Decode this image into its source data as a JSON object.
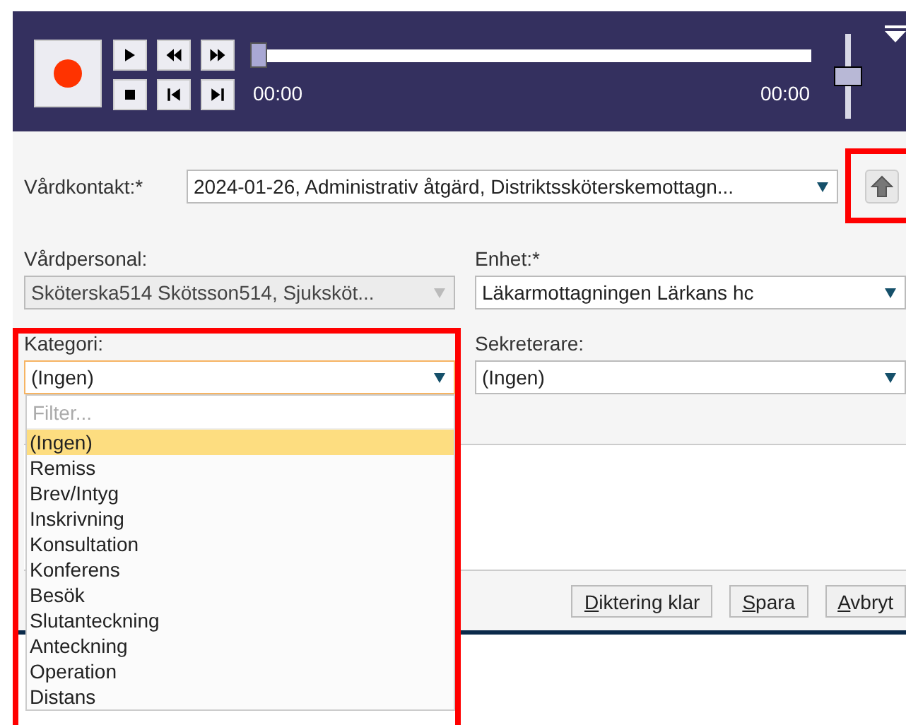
{
  "player": {
    "elapsed": "00:00",
    "duration": "00:00",
    "progress": {
      "level": 0
    },
    "volume": {
      "level": 0.5
    }
  },
  "contact": {
    "label": "Vårdkontakt:*",
    "value": "2024-01-26, Administrativ åtgärd, Distriktssköterskemottagn...",
    "disabled": false,
    "focused": false
  },
  "fields": [
    {
      "label": "Vårdpersonal:",
      "value": "Sköterska514 Skötsson514, Sjuksköt...",
      "disabled": true,
      "focused": false
    },
    {
      "label": "Enhet:*",
      "value": "Läkarmottagningen Lärkans hc",
      "disabled": false,
      "focused": false
    },
    {
      "label": "Kategori:",
      "value": "(Ingen)",
      "disabled": false,
      "focused": true
    },
    {
      "label": "Sekreterare:",
      "value": "(Ingen)",
      "disabled": false,
      "focused": false
    }
  ],
  "dropdown": {
    "placeholder": "Filter...",
    "options": [
      {
        "label": "(Ingen)",
        "selected": true
      },
      {
        "label": "Remiss",
        "selected": false
      },
      {
        "label": "Brev/Intyg",
        "selected": false
      },
      {
        "label": "Inskrivning",
        "selected": false
      },
      {
        "label": "Konsultation",
        "selected": false
      },
      {
        "label": "Konferens",
        "selected": false
      },
      {
        "label": "Besök",
        "selected": false
      },
      {
        "label": "Slutanteckning",
        "selected": false
      },
      {
        "label": "Anteckning",
        "selected": false
      },
      {
        "label": "Operation",
        "selected": false
      },
      {
        "label": "Distans",
        "selected": false
      }
    ]
  },
  "buttons": [
    "Diktering klar",
    "Spara",
    "Avbryt"
  ]
}
